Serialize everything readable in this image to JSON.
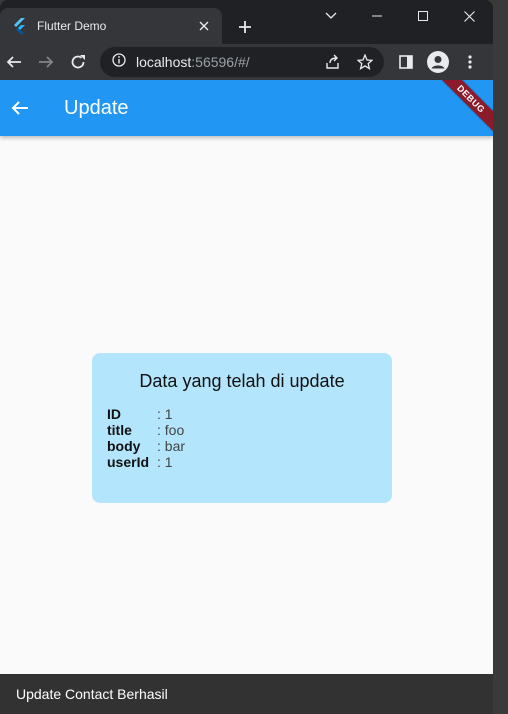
{
  "browser": {
    "tab": {
      "title": "Flutter Demo"
    },
    "url": {
      "host": "localhost",
      "rest": ":56596/#/"
    }
  },
  "app": {
    "title": "Update",
    "debug_label": "DEBUG",
    "card": {
      "heading": "Data yang telah di update",
      "fields": [
        {
          "key": "ID",
          "value": ": 1"
        },
        {
          "key": "title",
          "value": ": foo"
        },
        {
          "key": "body",
          "value": ": bar"
        },
        {
          "key": "userId",
          "value": ": 1"
        }
      ]
    },
    "snackbar": {
      "message": "Update Contact Berhasil"
    }
  },
  "colors": {
    "appbar": "#2196f3",
    "card": "#b3e5fc",
    "snackbar": "#323232",
    "debug_banner": "#8b1a2b"
  }
}
